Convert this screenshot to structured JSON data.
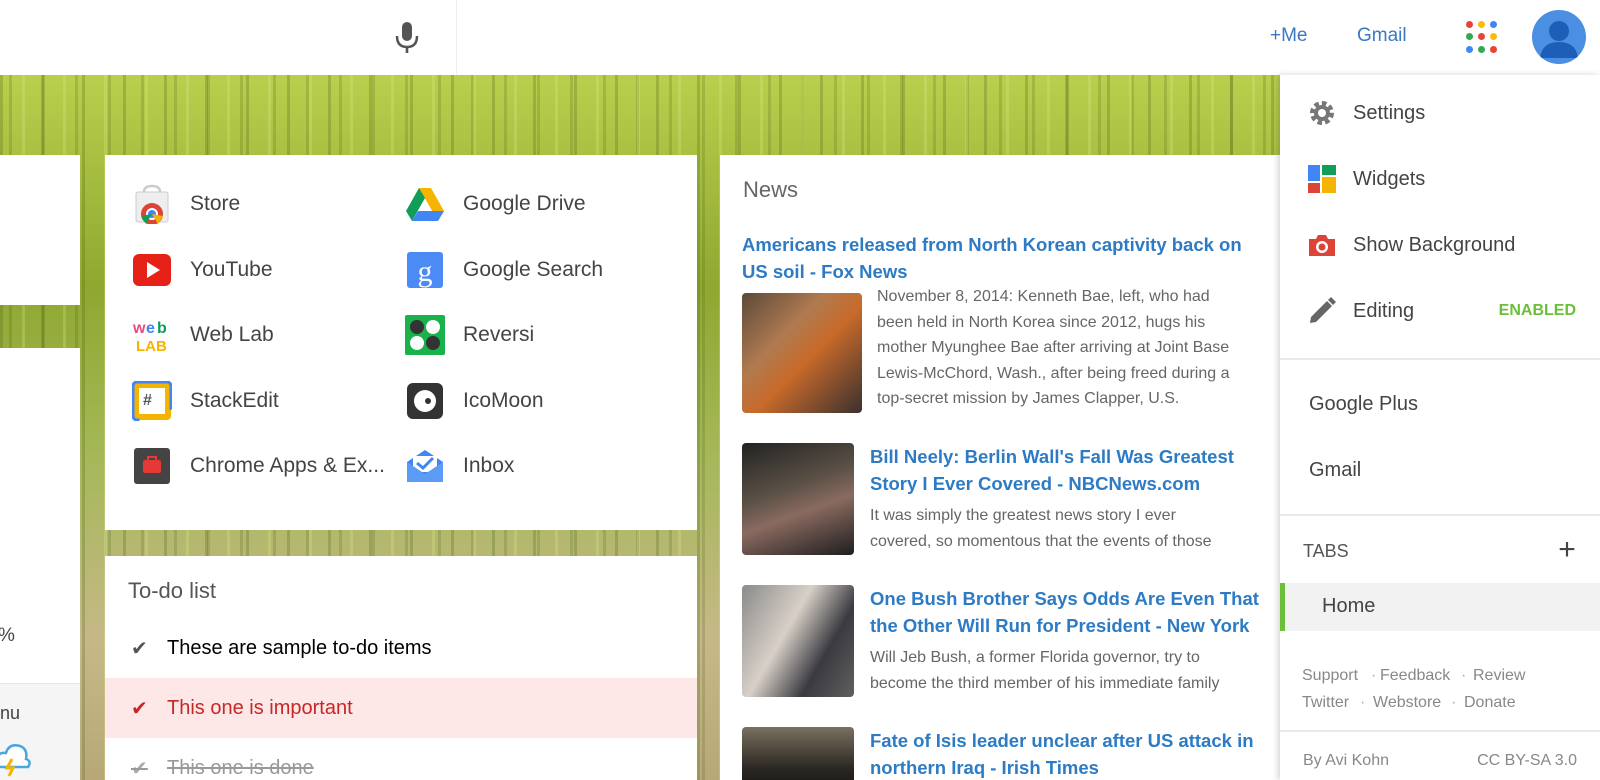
{
  "topbar": {
    "plus_me": "+Me",
    "gmail": "Gmail"
  },
  "left": {
    "percent": "%",
    "partial_text": "nu"
  },
  "apps": [
    {
      "label": "Store",
      "icon": "chrome-store-icon"
    },
    {
      "label": "Google Drive",
      "icon": "google-drive-icon"
    },
    {
      "label": "YouTube",
      "icon": "youtube-icon"
    },
    {
      "label": "Google Search",
      "icon": "google-search-icon"
    },
    {
      "label": "Web Lab",
      "icon": "web-lab-icon"
    },
    {
      "label": "Reversi",
      "icon": "reversi-icon"
    },
    {
      "label": "StackEdit",
      "icon": "stackedit-icon"
    },
    {
      "label": "IcoMoon",
      "icon": "icomoon-icon"
    },
    {
      "label": "Chrome Apps & Ex...",
      "icon": "chrome-apps-icon"
    },
    {
      "label": "Inbox",
      "icon": "inbox-icon"
    }
  ],
  "todo": {
    "title": "To-do list",
    "items": [
      {
        "text": "These are sample to-do items",
        "state": "normal"
      },
      {
        "text": "This one is important",
        "state": "important"
      },
      {
        "text": "This one is done",
        "state": "done"
      }
    ]
  },
  "news": {
    "title": "News",
    "items": [
      {
        "headline_1": "Americans released from North Korean captivity back on",
        "headline_2": "US soil - Fox News",
        "body": [
          "November 8, 2014: Kenneth Bae, left, who had",
          "been held in North Korea since 2012, hugs his",
          "mother Myunghee Bae after arriving at Joint Base",
          "Lewis-McChord, Wash., after being freed during a",
          "top-secret mission by James Clapper, U.S."
        ]
      },
      {
        "headline_1": "Bill Neely: Berlin Wall's Fall Was Greatest",
        "headline_2": "Story I Ever Covered - NBCNews.com",
        "body": [
          "It was simply the greatest news story I ever",
          "covered, so momentous that the events of those"
        ]
      },
      {
        "headline_1": "One Bush Brother Says Odds Are Even That",
        "headline_2": "the Other Will Run for President - New York",
        "body": [
          "Will Jeb Bush, a former Florida governor, try to",
          "become the third member of his immediate family"
        ]
      },
      {
        "headline_1": "Fate of Isis leader unclear after US attack in",
        "headline_2": "northern Iraq - Irish Times",
        "body": []
      }
    ]
  },
  "menu": {
    "settings": "Settings",
    "widgets": "Widgets",
    "show_background": "Show Background",
    "editing": "Editing",
    "editing_status": "ENABLED",
    "google_plus": "Google Plus",
    "gmail": "Gmail",
    "tabs_label": "TABS",
    "tabs_add": "+",
    "home_tab": "Home",
    "footer_links": {
      "support": "Support",
      "feedback": "Feedback",
      "review": "Review",
      "twitter": "Twitter",
      "webstore": "Webstore",
      "donate": "Donate"
    },
    "separator": "·",
    "author": "By Avi Kohn",
    "license": "CC BY-SA 3.0"
  },
  "colors": {
    "link_blue": "#2d7bc4",
    "enabled_green": "#6cbf3a",
    "important_red": "#c62828"
  }
}
